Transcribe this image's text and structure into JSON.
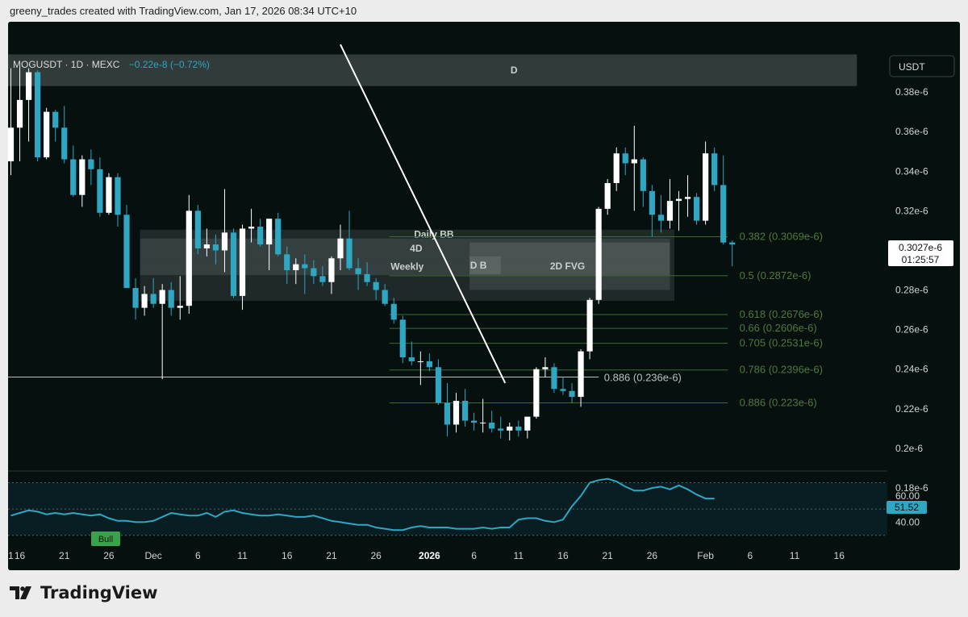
{
  "header": {
    "attribution": "greeny_trades created with TradingView.com, Jan 17, 2026 08:34 UTC+10"
  },
  "chart": {
    "symbol": "MOGUSDT · 1D · MEXC",
    "change": "−0.22e-8 (−0.72%)",
    "currency": "USDT",
    "last_price": "0.3027e-6",
    "countdown": "01:25:57"
  },
  "chart_data": {
    "type": "candlestick",
    "price_unit": "e-6",
    "ylim": [
      0.18,
      0.4
    ],
    "y_ticks": [
      "0.38e-6",
      "0.36e-6",
      "0.34e-6",
      "0.32e-6",
      "0.3e-6",
      "0.28e-6",
      "0.26e-6",
      "0.24e-6",
      "0.22e-6",
      "0.2e-6",
      "0.18e-6"
    ],
    "y_tick_values": [
      0.38,
      0.36,
      0.34,
      0.32,
      0.3,
      0.28,
      0.26,
      0.24,
      0.22,
      0.2,
      0.18
    ],
    "x_ticks": [
      {
        "label": "1",
        "day": 0,
        "bold": false
      },
      {
        "label": "16",
        "day": 1,
        "bold": false
      },
      {
        "label": "21",
        "day": 6,
        "bold": false
      },
      {
        "label": "26",
        "day": 11,
        "bold": false
      },
      {
        "label": "Dec",
        "day": 16,
        "bold": false
      },
      {
        "label": "6",
        "day": 21,
        "bold": false
      },
      {
        "label": "11",
        "day": 26,
        "bold": false
      },
      {
        "label": "16",
        "day": 31,
        "bold": false
      },
      {
        "label": "21",
        "day": 36,
        "bold": false
      },
      {
        "label": "26",
        "day": 41,
        "bold": false
      },
      {
        "label": "2026",
        "day": 47,
        "bold": true
      },
      {
        "label": "6",
        "day": 52,
        "bold": false
      },
      {
        "label": "11",
        "day": 57,
        "bold": false
      },
      {
        "label": "16",
        "day": 62,
        "bold": false
      },
      {
        "label": "21",
        "day": 67,
        "bold": false
      },
      {
        "label": "26",
        "day": 72,
        "bold": false
      },
      {
        "label": "Feb",
        "day": 78,
        "bold": false
      },
      {
        "label": "6",
        "day": 83,
        "bold": false
      },
      {
        "label": "11",
        "day": 88,
        "bold": false
      },
      {
        "label": "16",
        "day": 93,
        "bold": false
      }
    ],
    "candles": [
      {
        "o": 0.345,
        "h": 0.392,
        "l": 0.338,
        "c": 0.362
      },
      {
        "o": 0.362,
        "h": 0.393,
        "l": 0.345,
        "c": 0.376
      },
      {
        "o": 0.376,
        "h": 0.392,
        "l": 0.355,
        "c": 0.39
      },
      {
        "o": 0.39,
        "h": 0.391,
        "l": 0.345,
        "c": 0.347
      },
      {
        "o": 0.347,
        "h": 0.372,
        "l": 0.346,
        "c": 0.37
      },
      {
        "o": 0.37,
        "h": 0.371,
        "l": 0.355,
        "c": 0.362
      },
      {
        "o": 0.362,
        "h": 0.373,
        "l": 0.344,
        "c": 0.346
      },
      {
        "o": 0.346,
        "h": 0.353,
        "l": 0.327,
        "c": 0.328
      },
      {
        "o": 0.328,
        "h": 0.348,
        "l": 0.322,
        "c": 0.346
      },
      {
        "o": 0.346,
        "h": 0.351,
        "l": 0.333,
        "c": 0.341
      },
      {
        "o": 0.341,
        "h": 0.347,
        "l": 0.317,
        "c": 0.319
      },
      {
        "o": 0.319,
        "h": 0.339,
        "l": 0.318,
        "c": 0.337
      },
      {
        "o": 0.337,
        "h": 0.339,
        "l": 0.312,
        "c": 0.318
      },
      {
        "o": 0.318,
        "h": 0.323,
        "l": 0.281,
        "c": 0.281
      },
      {
        "o": 0.281,
        "h": 0.286,
        "l": 0.265,
        "c": 0.271
      },
      {
        "o": 0.271,
        "h": 0.282,
        "l": 0.267,
        "c": 0.278
      },
      {
        "o": 0.278,
        "h": 0.286,
        "l": 0.271,
        "c": 0.273
      },
      {
        "o": 0.273,
        "h": 0.283,
        "l": 0.235,
        "c": 0.28
      },
      {
        "o": 0.28,
        "h": 0.284,
        "l": 0.267,
        "c": 0.271
      },
      {
        "o": 0.271,
        "h": 0.287,
        "l": 0.265,
        "c": 0.272
      },
      {
        "o": 0.272,
        "h": 0.328,
        "l": 0.268,
        "c": 0.32
      },
      {
        "o": 0.32,
        "h": 0.323,
        "l": 0.298,
        "c": 0.301
      },
      {
        "o": 0.301,
        "h": 0.311,
        "l": 0.297,
        "c": 0.303
      },
      {
        "o": 0.303,
        "h": 0.308,
        "l": 0.293,
        "c": 0.3
      },
      {
        "o": 0.3,
        "h": 0.331,
        "l": 0.289,
        "c": 0.309
      },
      {
        "o": 0.309,
        "h": 0.311,
        "l": 0.276,
        "c": 0.277
      },
      {
        "o": 0.277,
        "h": 0.313,
        "l": 0.27,
        "c": 0.311
      },
      {
        "o": 0.311,
        "h": 0.321,
        "l": 0.304,
        "c": 0.312
      },
      {
        "o": 0.312,
        "h": 0.316,
        "l": 0.302,
        "c": 0.303
      },
      {
        "o": 0.303,
        "h": 0.314,
        "l": 0.29,
        "c": 0.316
      },
      {
        "o": 0.316,
        "h": 0.319,
        "l": 0.297,
        "c": 0.298
      },
      {
        "o": 0.298,
        "h": 0.302,
        "l": 0.283,
        "c": 0.29
      },
      {
        "o": 0.29,
        "h": 0.296,
        "l": 0.283,
        "c": 0.293
      },
      {
        "o": 0.293,
        "h": 0.298,
        "l": 0.278,
        "c": 0.291
      },
      {
        "o": 0.291,
        "h": 0.295,
        "l": 0.283,
        "c": 0.287
      },
      {
        "o": 0.287,
        "h": 0.292,
        "l": 0.282,
        "c": 0.284
      },
      {
        "o": 0.284,
        "h": 0.297,
        "l": 0.278,
        "c": 0.296
      },
      {
        "o": 0.296,
        "h": 0.313,
        "l": 0.29,
        "c": 0.306
      },
      {
        "o": 0.306,
        "h": 0.32,
        "l": 0.29,
        "c": 0.291
      },
      {
        "o": 0.291,
        "h": 0.296,
        "l": 0.28,
        "c": 0.288
      },
      {
        "o": 0.288,
        "h": 0.294,
        "l": 0.282,
        "c": 0.284
      },
      {
        "o": 0.284,
        "h": 0.286,
        "l": 0.275,
        "c": 0.28
      },
      {
        "o": 0.28,
        "h": 0.283,
        "l": 0.272,
        "c": 0.273
      },
      {
        "o": 0.273,
        "h": 0.276,
        "l": 0.263,
        "c": 0.265
      },
      {
        "o": 0.265,
        "h": 0.267,
        "l": 0.243,
        "c": 0.246
      },
      {
        "o": 0.246,
        "h": 0.254,
        "l": 0.242,
        "c": 0.244
      },
      {
        "o": 0.244,
        "h": 0.249,
        "l": 0.232,
        "c": 0.244
      },
      {
        "o": 0.244,
        "h": 0.248,
        "l": 0.239,
        "c": 0.241
      },
      {
        "o": 0.241,
        "h": 0.245,
        "l": 0.222,
        "c": 0.223
      },
      {
        "o": 0.223,
        "h": 0.233,
        "l": 0.206,
        "c": 0.212
      },
      {
        "o": 0.212,
        "h": 0.228,
        "l": 0.208,
        "c": 0.224
      },
      {
        "o": 0.224,
        "h": 0.23,
        "l": 0.211,
        "c": 0.214
      },
      {
        "o": 0.214,
        "h": 0.218,
        "l": 0.209,
        "c": 0.213
      },
      {
        "o": 0.213,
        "h": 0.225,
        "l": 0.208,
        "c": 0.213
      },
      {
        "o": 0.213,
        "h": 0.219,
        "l": 0.208,
        "c": 0.21
      },
      {
        "o": 0.21,
        "h": 0.216,
        "l": 0.205,
        "c": 0.209
      },
      {
        "o": 0.209,
        "h": 0.213,
        "l": 0.204,
        "c": 0.211
      },
      {
        "o": 0.211,
        "h": 0.214,
        "l": 0.206,
        "c": 0.209
      },
      {
        "o": 0.209,
        "h": 0.216,
        "l": 0.205,
        "c": 0.216
      },
      {
        "o": 0.216,
        "h": 0.241,
        "l": 0.215,
        "c": 0.24
      },
      {
        "o": 0.24,
        "h": 0.246,
        "l": 0.236,
        "c": 0.241
      },
      {
        "o": 0.241,
        "h": 0.243,
        "l": 0.228,
        "c": 0.23
      },
      {
        "o": 0.23,
        "h": 0.236,
        "l": 0.227,
        "c": 0.229
      },
      {
        "o": 0.229,
        "h": 0.233,
        "l": 0.223,
        "c": 0.226
      },
      {
        "o": 0.226,
        "h": 0.25,
        "l": 0.221,
        "c": 0.249
      },
      {
        "o": 0.249,
        "h": 0.276,
        "l": 0.245,
        "c": 0.275
      },
      {
        "o": 0.275,
        "h": 0.322,
        "l": 0.273,
        "c": 0.321
      },
      {
        "o": 0.321,
        "h": 0.336,
        "l": 0.318,
        "c": 0.334
      },
      {
        "o": 0.334,
        "h": 0.352,
        "l": 0.33,
        "c": 0.349
      },
      {
        "o": 0.349,
        "h": 0.352,
        "l": 0.338,
        "c": 0.344
      },
      {
        "o": 0.344,
        "h": 0.363,
        "l": 0.32,
        "c": 0.346
      },
      {
        "o": 0.346,
        "h": 0.347,
        "l": 0.322,
        "c": 0.33
      },
      {
        "o": 0.33,
        "h": 0.333,
        "l": 0.307,
        "c": 0.318
      },
      {
        "o": 0.318,
        "h": 0.328,
        "l": 0.309,
        "c": 0.315
      },
      {
        "o": 0.315,
        "h": 0.336,
        "l": 0.311,
        "c": 0.325
      },
      {
        "o": 0.325,
        "h": 0.33,
        "l": 0.31,
        "c": 0.326
      },
      {
        "o": 0.326,
        "h": 0.338,
        "l": 0.317,
        "c": 0.327
      },
      {
        "o": 0.327,
        "h": 0.329,
        "l": 0.313,
        "c": 0.315
      },
      {
        "o": 0.315,
        "h": 0.355,
        "l": 0.313,
        "c": 0.349
      },
      {
        "o": 0.349,
        "h": 0.352,
        "l": 0.33,
        "c": 0.333
      },
      {
        "o": 0.333,
        "h": 0.348,
        "l": 0.303,
        "c": 0.304
      },
      {
        "o": 0.304,
        "h": 0.305,
        "l": 0.292,
        "c": 0.303
      }
    ],
    "zones": [
      {
        "label": "D",
        "top": 0.399,
        "bottom": 0.383,
        "day_start": -0.7,
        "day_end": 95
      },
      {
        "label": "Daily BB",
        "top": 0.3105,
        "bottom": 0.2745,
        "day_start": 14.5,
        "day_end": 74.5
      },
      {
        "label": "4D",
        "top": 0.306,
        "bottom": 0.296,
        "day_start": 14.5,
        "day_end": 74
      },
      {
        "label": "Weekly",
        "top": 0.296,
        "bottom": 0.2875,
        "day_start": 14.5,
        "day_end": 74
      },
      {
        "label": "D B",
        "top": 0.297,
        "bottom": 0.288,
        "day_start": 51.5,
        "day_end": 55
      },
      {
        "label": "2D FVG",
        "top": 0.304,
        "bottom": 0.28,
        "day_start": 51.5,
        "day_end": 74
      }
    ],
    "fib_levels": [
      {
        "label": "0.382 (0.3069e-6)",
        "value": 0.3069
      },
      {
        "label": "0.5 (0.2872e-6)",
        "value": 0.2872
      },
      {
        "label": "0.618 (0.2676e-6)",
        "value": 0.2676
      },
      {
        "label": "0.66 (0.2606e-6)",
        "value": 0.2606
      },
      {
        "label": "0.705 (0.2531e-6)",
        "value": 0.2531
      },
      {
        "label": "0.786 (0.2396e-6)",
        "value": 0.2396
      },
      {
        "label": "0.886 (0.223e-6)",
        "value": 0.223
      }
    ],
    "horizontal_line": {
      "label": "0.886 (0.236e-6)",
      "value": 0.236
    },
    "trendline": {
      "day_start": 37,
      "value_start": 0.404,
      "day_end": 55.5,
      "value_end": 0.233
    },
    "oscillator": {
      "ticks": [
        "60.00",
        "40.00"
      ],
      "tick_values": [
        60,
        40
      ],
      "ylim": [
        28,
        74
      ],
      "bands": [
        50,
        30
      ],
      "current_value": "51.52",
      "current": 51.52,
      "badge": "Bull",
      "values": [
        45,
        47,
        49,
        48,
        46,
        47,
        46,
        47,
        46,
        45,
        46,
        43,
        41,
        41,
        40,
        40,
        41,
        44,
        47,
        46,
        45,
        45,
        47,
        44,
        48,
        49,
        47,
        46,
        45,
        45,
        46,
        45,
        44,
        44,
        45,
        43,
        41,
        40,
        39,
        38,
        38,
        36,
        35,
        34,
        34,
        36,
        37,
        36,
        36,
        36,
        35,
        35,
        35,
        36,
        35,
        36,
        36,
        42,
        43,
        43,
        41,
        40,
        42,
        52,
        60,
        70,
        72,
        73,
        71,
        67,
        64,
        64,
        66,
        67,
        65,
        68,
        65,
        61,
        58,
        58
      ]
    }
  },
  "colors": {
    "background": "#05100f",
    "up_candle": "#ffffff",
    "down_candle": "#2fa7c2",
    "fib_line": "#3e6b30",
    "fib_text": "#4f7a3e",
    "zone": "#cfd8d6",
    "oscillator_line": "#2fa7c2",
    "bull_badge": "#3aa24a"
  },
  "brand": {
    "name": "TradingView",
    "logo": "tradingview-logo-icon"
  }
}
